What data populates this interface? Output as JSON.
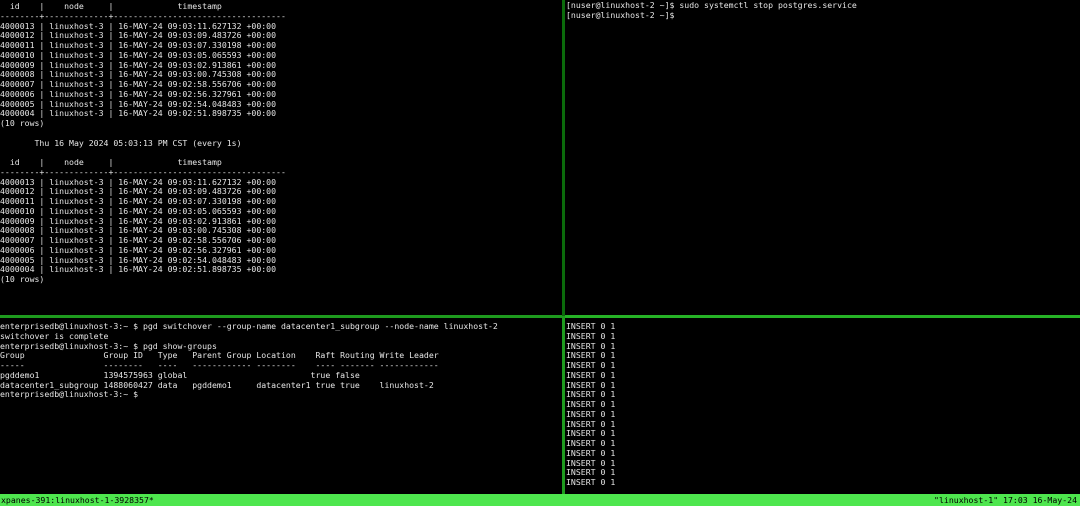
{
  "panes": {
    "top_left": {
      "lines": [
        "  id    |    node     |             timestamp",
        "--------+-------------+-----------------------------------",
        "4000013 | linuxhost-3 | 16-MAY-24 09:03:11.627132 +00:00",
        "4000012 | linuxhost-3 | 16-MAY-24 09:03:09.483726 +00:00",
        "4000011 | linuxhost-3 | 16-MAY-24 09:03:07.330198 +00:00",
        "4000010 | linuxhost-3 | 16-MAY-24 09:03:05.065593 +00:00",
        "4000009 | linuxhost-3 | 16-MAY-24 09:03:02.913861 +00:00",
        "4000008 | linuxhost-3 | 16-MAY-24 09:03:00.745308 +00:00",
        "4000007 | linuxhost-3 | 16-MAY-24 09:02:58.556706 +00:00",
        "4000006 | linuxhost-3 | 16-MAY-24 09:02:56.327961 +00:00",
        "4000005 | linuxhost-3 | 16-MAY-24 09:02:54.048483 +00:00",
        "4000004 | linuxhost-3 | 16-MAY-24 09:02:51.898735 +00:00",
        "(10 rows)",
        "",
        "       Thu 16 May 2024 05:03:13 PM CST (every 1s)",
        "",
        "  id    |    node     |             timestamp",
        "--------+-------------+-----------------------------------",
        "4000013 | linuxhost-3 | 16-MAY-24 09:03:11.627132 +00:00",
        "4000012 | linuxhost-3 | 16-MAY-24 09:03:09.483726 +00:00",
        "4000011 | linuxhost-3 | 16-MAY-24 09:03:07.330198 +00:00",
        "4000010 | linuxhost-3 | 16-MAY-24 09:03:05.065593 +00:00",
        "4000009 | linuxhost-3 | 16-MAY-24 09:03:02.913861 +00:00",
        "4000008 | linuxhost-3 | 16-MAY-24 09:03:00.745308 +00:00",
        "4000007 | linuxhost-3 | 16-MAY-24 09:02:58.556706 +00:00",
        "4000006 | linuxhost-3 | 16-MAY-24 09:02:56.327961 +00:00",
        "4000005 | linuxhost-3 | 16-MAY-24 09:02:54.048483 +00:00",
        "4000004 | linuxhost-3 | 16-MAY-24 09:02:51.898735 +00:00",
        "(10 rows)"
      ]
    },
    "top_right": {
      "lines": [
        "[nuser@linuxhost-2 ~]$ sudo systemctl stop postgres.service",
        "[nuser@linuxhost-2 ~]$"
      ]
    },
    "bottom_left": {
      "lines": [
        "enterprisedb@linuxhost-3:~ $ pgd switchover --group-name datacenter1_subgroup --node-name linuxhost-2",
        "switchover is complete",
        "enterprisedb@linuxhost-3:~ $ pgd show-groups",
        "Group                Group ID   Type   Parent Group Location    Raft Routing Write Leader",
        "-----                --------   ----   ------------ --------    ---- ------- ------------",
        "pgddemo1             1394575963 global                         true false",
        "datacenter1_subgroup 1488060427 data   pgddemo1     datacenter1 true true    linuxhost-2",
        "enterprisedb@linuxhost-3:~ $"
      ]
    },
    "bottom_right": {
      "lines": [
        "INSERT 0 1",
        "INSERT 0 1",
        "INSERT 0 1",
        "INSERT 0 1",
        "INSERT 0 1",
        "INSERT 0 1",
        "INSERT 0 1",
        "INSERT 0 1",
        "INSERT 0 1",
        "INSERT 0 1",
        "INSERT 0 1",
        "INSERT 0 1",
        "INSERT 0 1",
        "INSERT 0 1",
        "INSERT 0 1",
        "INSERT 0 1",
        "INSERT 0 1"
      ]
    }
  },
  "status_bar": {
    "left": "xpanes-391:linuxhost-1-3928357*",
    "right": "\"linuxhost-1\" 17:03 16-May-24"
  },
  "colors": {
    "background": "#000000",
    "text": "#e6e6e6",
    "status_bar": "#4ee64e",
    "active_border": "#26b226"
  }
}
